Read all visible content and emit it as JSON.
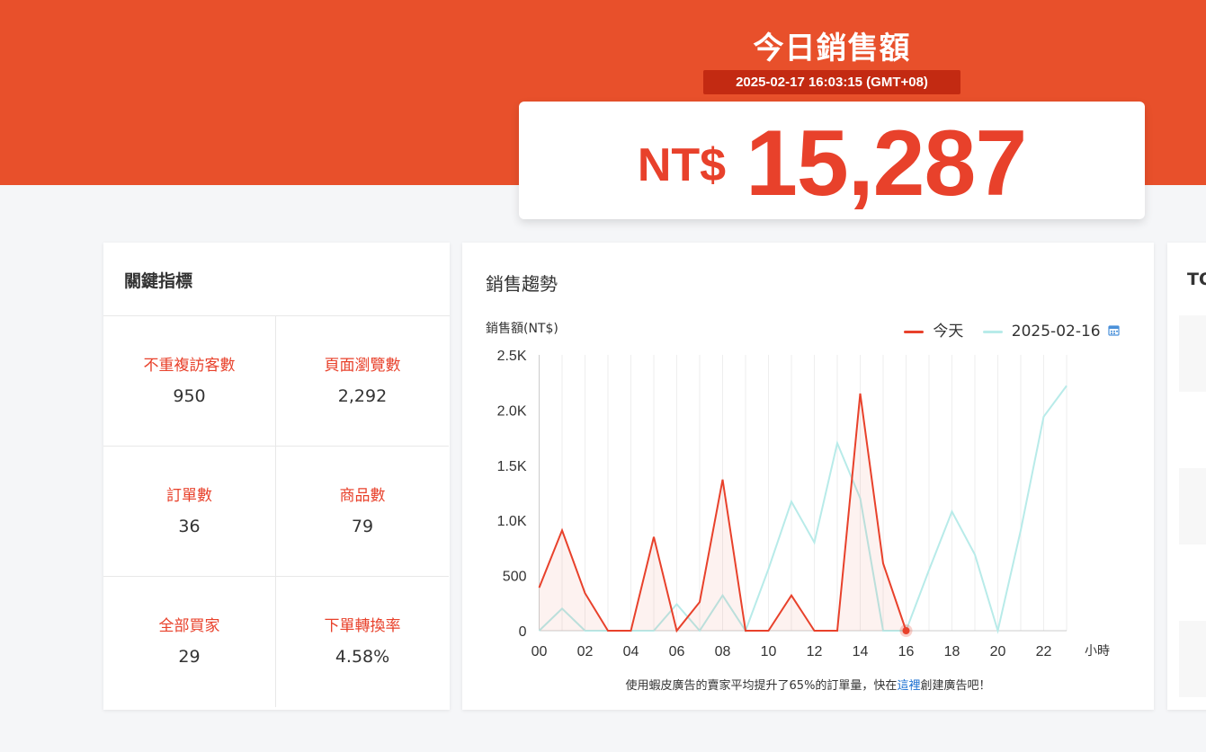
{
  "hero": {
    "title": "今日銷售額",
    "timestamp": "2025-02-17 16:03:15 (GMT+08)",
    "currency": "NT$",
    "amount": "15,287"
  },
  "kpi": {
    "title": "關鍵指標",
    "items": [
      {
        "label": "不重複訪客數",
        "value": "950"
      },
      {
        "label": "頁面瀏覽數",
        "value": "2,292"
      },
      {
        "label": "訂單數",
        "value": "36"
      },
      {
        "label": "商品數",
        "value": "79"
      },
      {
        "label": "全部買家",
        "value": "29"
      },
      {
        "label": "下單轉換率",
        "value": "4.58%"
      }
    ]
  },
  "trend": {
    "title": "銷售趨勢",
    "footnote_prefix": "使用蝦皮廣告的賣家平均提升了65%的訂單量，快在",
    "footnote_link": "這裡",
    "footnote_suffix": "創建廣告吧！"
  },
  "top": {
    "title": "TO"
  },
  "colors": {
    "brand": "#e8502b",
    "today": "#e8412b",
    "yesterday": "#b8ebe9"
  },
  "chart_data": {
    "type": "line",
    "title": "",
    "ylabel": "銷售額(NT$)",
    "xlabel": "小時",
    "ylim": [
      0,
      2500
    ],
    "y_ticks": [
      "0",
      "500",
      "1.0K",
      "1.5K",
      "2.0K",
      "2.5K"
    ],
    "y_tick_values": [
      0,
      500,
      1000,
      1500,
      2000,
      2500
    ],
    "x_ticks": [
      "00",
      "02",
      "04",
      "06",
      "08",
      "10",
      "12",
      "14",
      "16",
      "18",
      "20",
      "22"
    ],
    "x_tick_values": [
      0,
      2,
      4,
      6,
      8,
      10,
      12,
      14,
      16,
      18,
      20,
      22
    ],
    "legend_position": "top-right",
    "grid": true,
    "series": [
      {
        "name": "今天",
        "x": [
          0,
          1,
          2,
          3,
          4,
          5,
          6,
          7,
          8,
          9,
          10,
          11,
          12,
          13,
          14,
          15,
          16
        ],
        "values": [
          390,
          910,
          340,
          0,
          0,
          850,
          0,
          260,
          1370,
          0,
          0,
          320,
          0,
          0,
          2150,
          610,
          0
        ]
      },
      {
        "name": "2025-02-16",
        "x": [
          0,
          1,
          2,
          3,
          4,
          5,
          6,
          7,
          8,
          9,
          10,
          11,
          12,
          13,
          14,
          15,
          16,
          17,
          18,
          19,
          20,
          21,
          22,
          23
        ],
        "values": [
          0,
          200,
          0,
          0,
          0,
          0,
          240,
          0,
          320,
          0,
          560,
          1170,
          800,
          1700,
          1200,
          0,
          0,
          550,
          1080,
          690,
          0,
          910,
          1940,
          2220
        ]
      }
    ]
  }
}
